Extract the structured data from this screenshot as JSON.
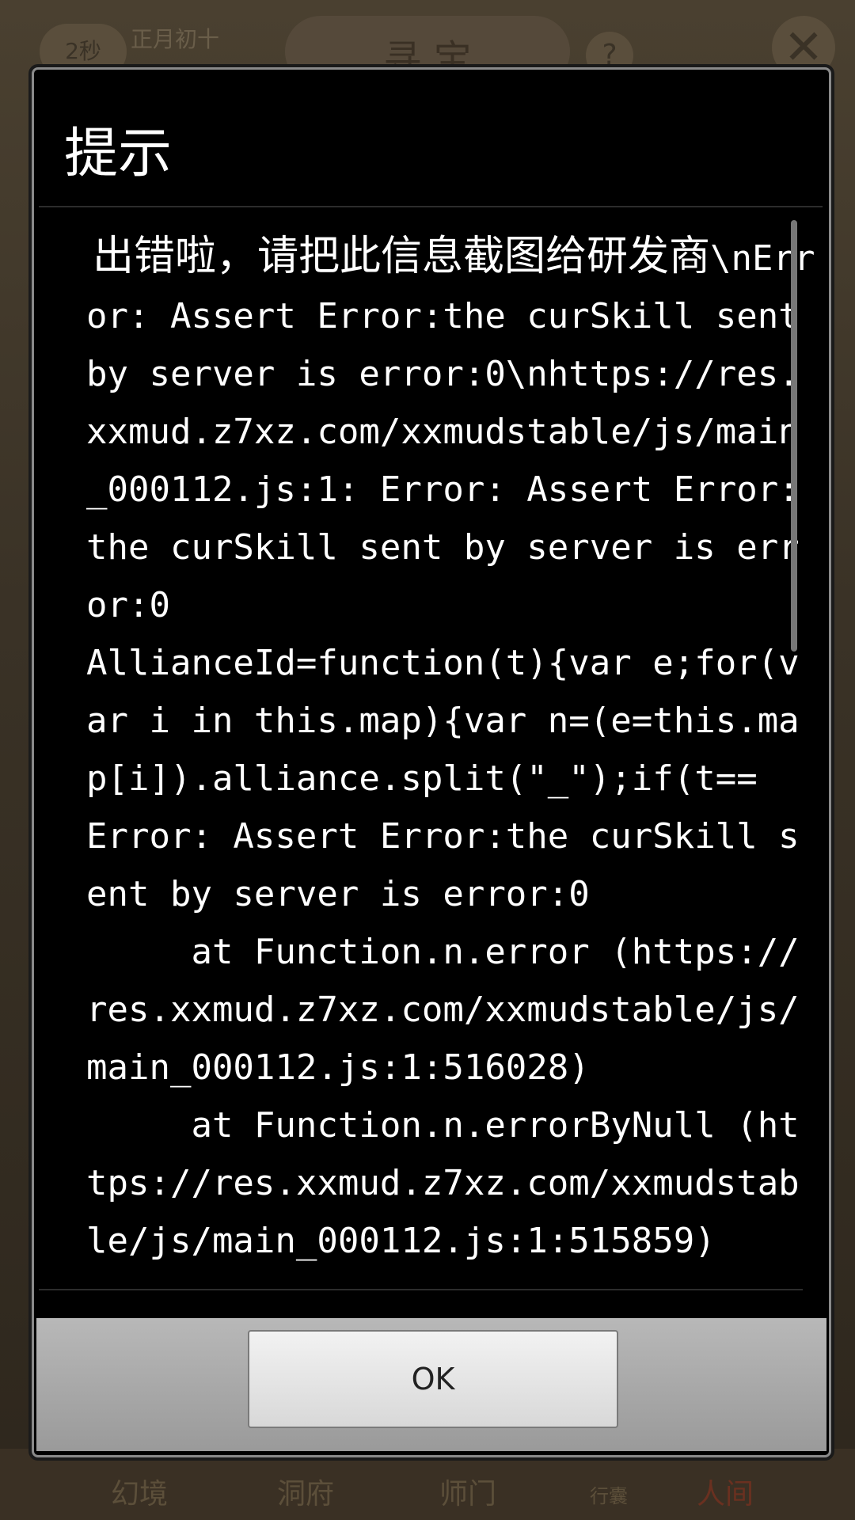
{
  "background": {
    "timer": "2秒",
    "date": "正月初十",
    "title": "寻 宝",
    "help_icon": "question-icon",
    "close_icon": "close-icon",
    "bottom_tabs": [
      "幻境",
      "洞府",
      "师门",
      "行囊",
      "人间"
    ]
  },
  "dialog": {
    "title": "提示",
    "message_cn": "出错啦，请把此信息截图给研发商",
    "message_body": "\\nError: Assert Error:the curSkill sent by server is error:0\\nhttps://res.xxmud.z7xz.com/xxmudstable/js/main_000112.js:1: Error: Assert Error:the curSkill sent by server is error:0\nAllianceId=function(t){var e;for(var i in this.map){var n=(e=this.map[i]).alliance.split(\"_\");if(t==\nError: Assert Error:the curSkill sent by server is error:0\n     at Function.n.error (https://res.xxmud.z7xz.com/xxmudstable/js/main_000112.js:1:516028)\n     at Function.n.errorByNull (https://res.xxmud.z7xz.com/xxmudstable/js/main_000112.js:1:515859)",
    "ok_label": "OK"
  }
}
